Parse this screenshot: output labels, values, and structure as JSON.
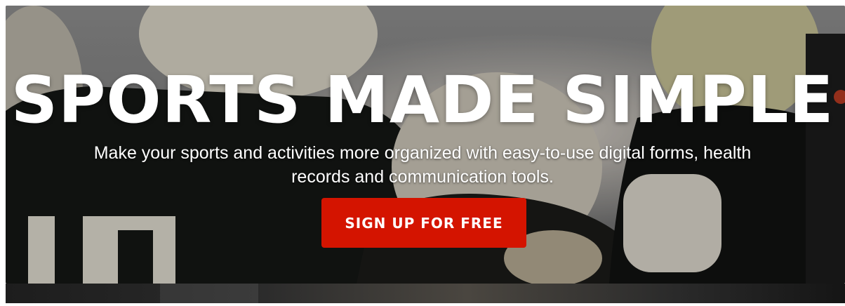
{
  "hero": {
    "headline": "SPORTS MADE SIMPLE",
    "subtext_line1": "Make your sports and activities more organized with easy-to-use digital forms, health",
    "subtext_line2": "records and communication tools.",
    "cta_label": "SIGN UP FOR FREE"
  },
  "colors": {
    "cta_background": "#d41400",
    "text": "#ffffff"
  }
}
